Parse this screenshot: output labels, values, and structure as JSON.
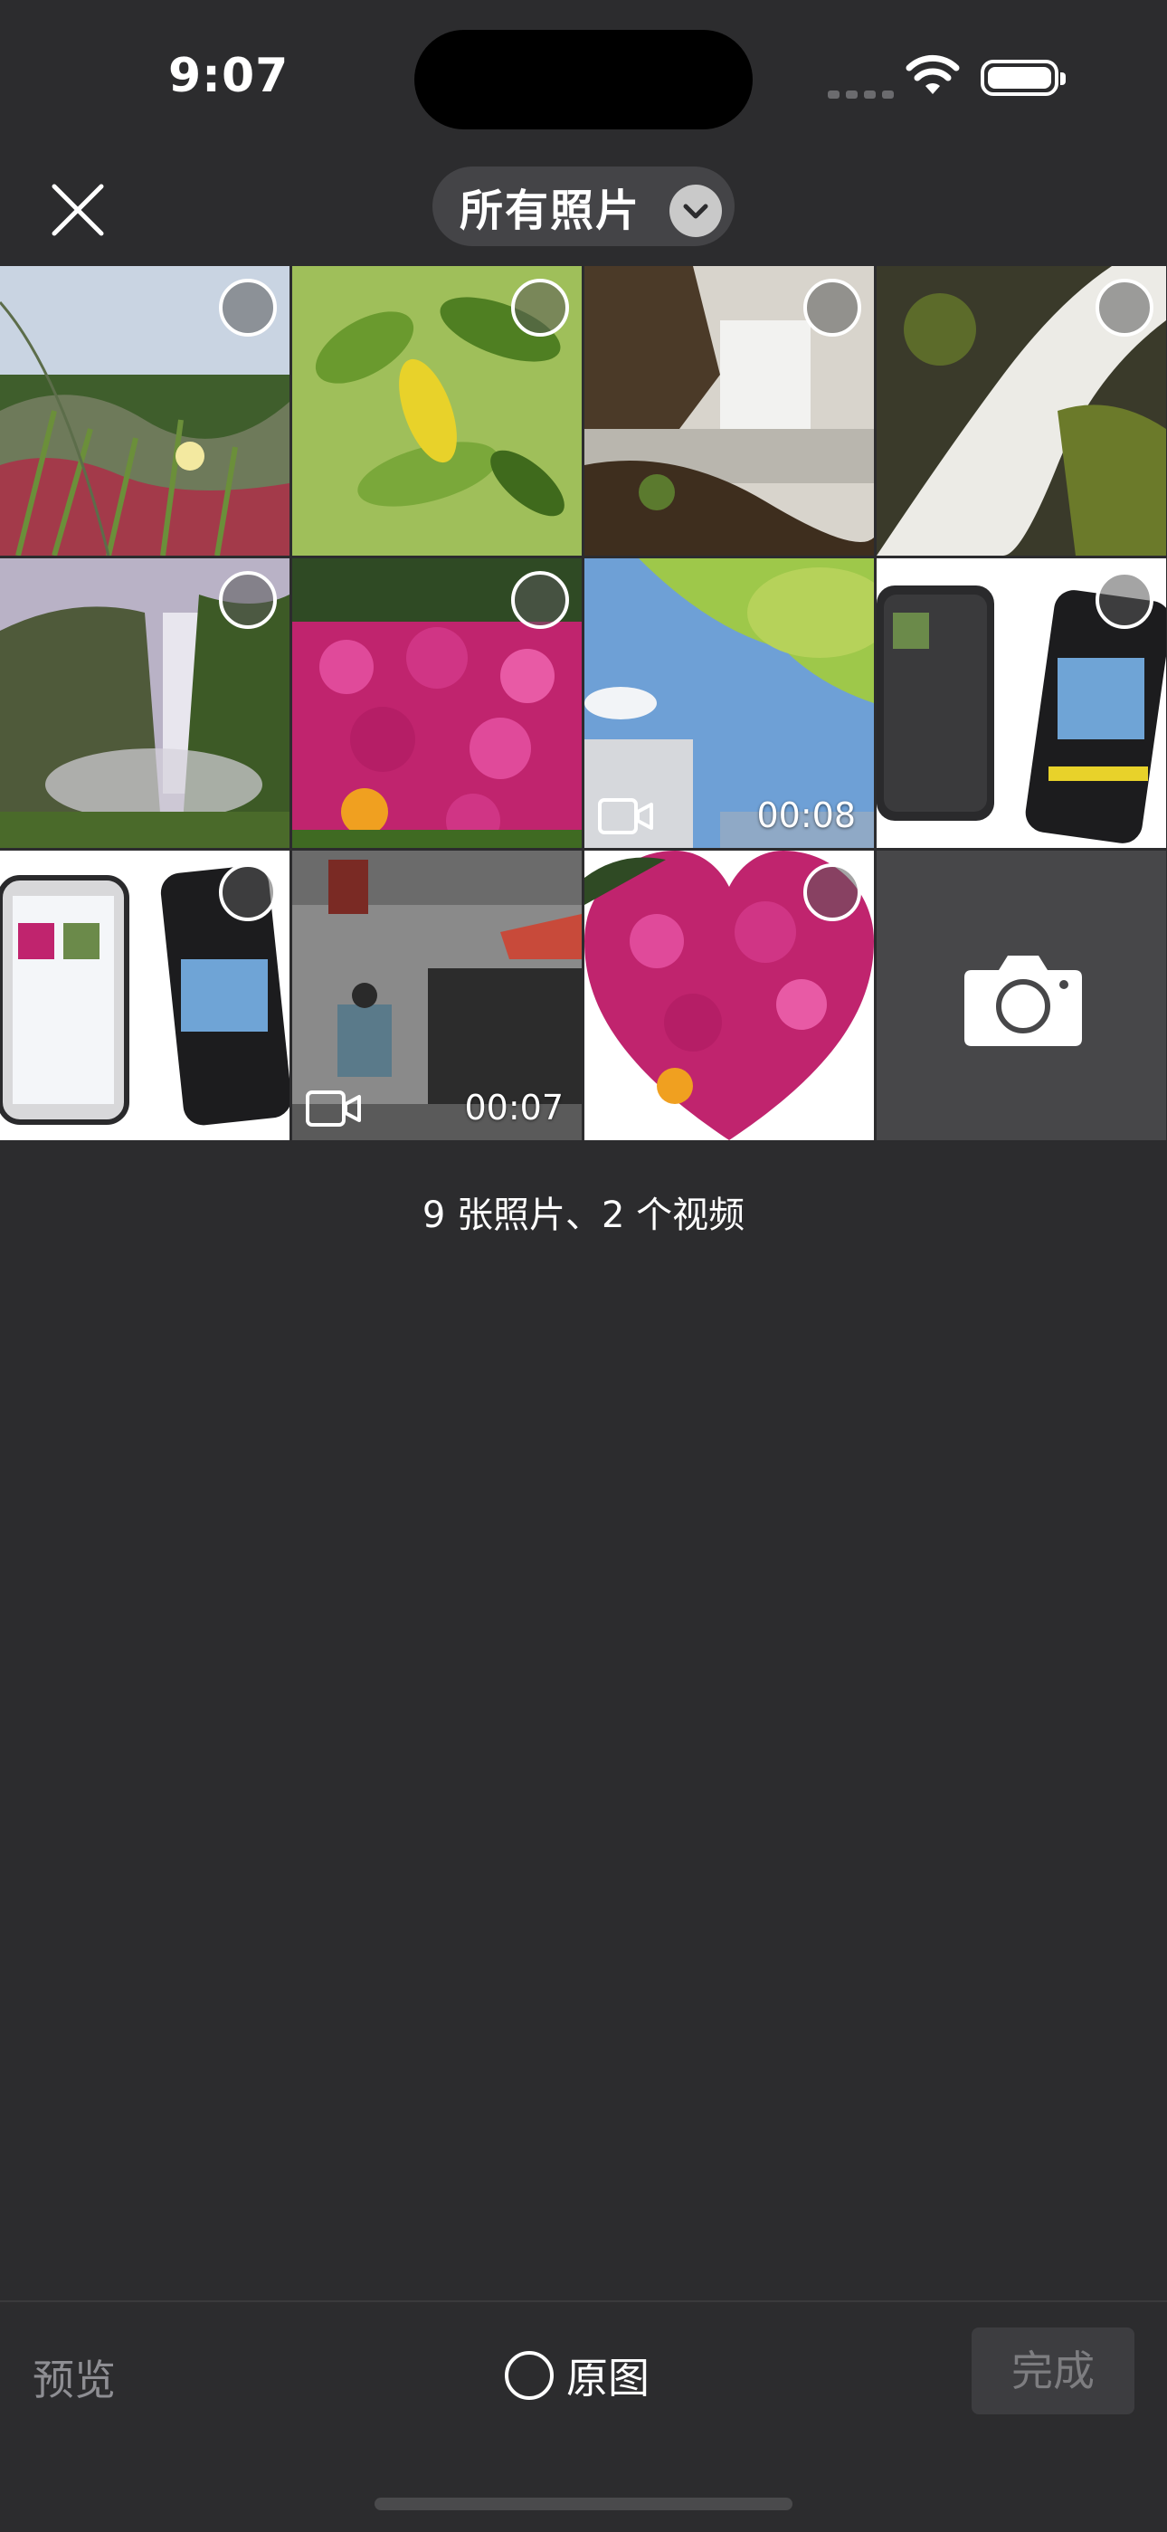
{
  "status": {
    "time": "9:07"
  },
  "nav": {
    "album_title": "所有照片"
  },
  "grid": {
    "items": [
      {
        "type": "photo"
      },
      {
        "type": "photo"
      },
      {
        "type": "photo"
      },
      {
        "type": "photo"
      },
      {
        "type": "photo"
      },
      {
        "type": "photo"
      },
      {
        "type": "video",
        "duration": "00:08"
      },
      {
        "type": "photo"
      },
      {
        "type": "photo"
      },
      {
        "type": "video",
        "duration": "00:07"
      },
      {
        "type": "photo"
      },
      {
        "type": "camera"
      }
    ]
  },
  "count_label": "9 张照片、2 个视频",
  "toolbar": {
    "preview_label": "预览",
    "original_label": "原图",
    "done_label": "完成"
  },
  "colors": {
    "background": "#2c2c2e",
    "pill": "#444447",
    "done_disabled": "#3d3d40"
  }
}
